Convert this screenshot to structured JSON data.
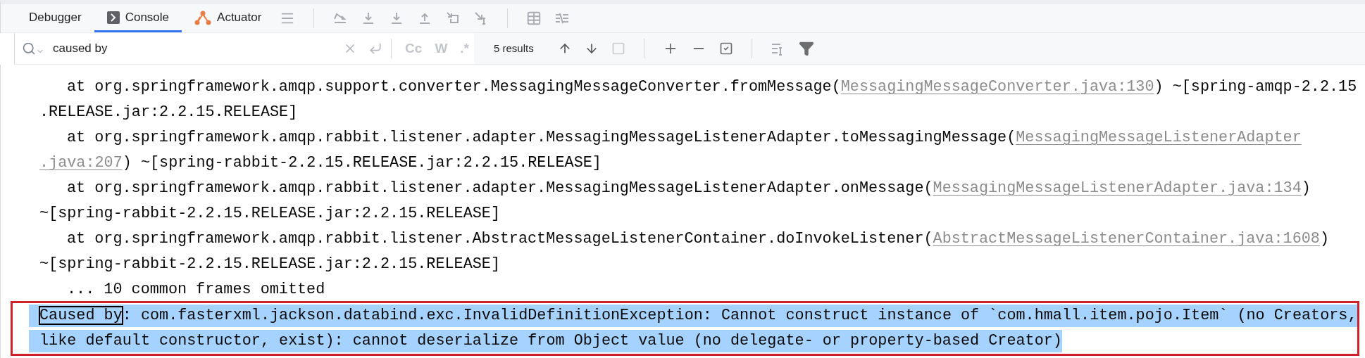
{
  "tabs": [
    {
      "label": "Debugger",
      "selected": false,
      "kind": "plain"
    },
    {
      "label": "Console",
      "selected": true,
      "kind": "console"
    },
    {
      "label": "Actuator",
      "selected": false,
      "kind": "actuator"
    }
  ],
  "search": {
    "value": "caused by",
    "toggles": [
      {
        "label": "Cc",
        "selected": false
      },
      {
        "label": "W",
        "selected": false
      },
      {
        "label": ".*",
        "selected": false
      }
    ],
    "result_count": "5 results"
  },
  "console": {
    "lines": [
      {
        "kind": "frame",
        "selected": false,
        "boxed": false,
        "segments": [
          {
            "kind": "text",
            "text": "at org.springframework.amqp.support.converter.MessagingMessageConverter.fromMessage("
          },
          {
            "kind": "link",
            "text": "MessagingMessageConverter.java:130"
          },
          {
            "kind": "text",
            "text": ") ~[spring-amqp-2.2.15"
          }
        ]
      },
      {
        "kind": "wrap",
        "selected": false,
        "boxed": false,
        "segments": [
          {
            "kind": "text",
            "text": ".RELEASE.jar:2.2.15.RELEASE]"
          }
        ]
      },
      {
        "kind": "frame",
        "selected": false,
        "boxed": false,
        "segments": [
          {
            "kind": "text",
            "text": "at org.springframework.amqp.rabbit.listener.adapter.MessagingMessageListenerAdapter.toMessagingMessage("
          },
          {
            "kind": "link",
            "text": "MessagingMessageListenerAdapter"
          }
        ]
      },
      {
        "kind": "wrap",
        "selected": false,
        "boxed": false,
        "segments": [
          {
            "kind": "link",
            "text": ".java:207"
          },
          {
            "kind": "text",
            "text": ") ~[spring-rabbit-2.2.15.RELEASE.jar:2.2.15.RELEASE]"
          }
        ]
      },
      {
        "kind": "frame",
        "selected": false,
        "boxed": false,
        "segments": [
          {
            "kind": "text",
            "text": "at org.springframework.amqp.rabbit.listener.adapter.MessagingMessageListenerAdapter.onMessage("
          },
          {
            "kind": "link",
            "text": "MessagingMessageListenerAdapter.java:134"
          },
          {
            "kind": "text",
            "text": ")"
          }
        ]
      },
      {
        "kind": "wrap",
        "selected": false,
        "boxed": false,
        "segments": [
          {
            "kind": "text",
            "text": "~[spring-rabbit-2.2.15.RELEASE.jar:2.2.15.RELEASE]"
          }
        ]
      },
      {
        "kind": "frame",
        "selected": false,
        "boxed": false,
        "segments": [
          {
            "kind": "text",
            "text": "at org.springframework.amqp.rabbit.listener.AbstractMessageListenerContainer.doInvokeListener("
          },
          {
            "kind": "link",
            "text": "AbstractMessageListenerContainer.java:1608"
          },
          {
            "kind": "text",
            "text": ")"
          }
        ]
      },
      {
        "kind": "wrap",
        "selected": false,
        "boxed": false,
        "segments": [
          {
            "kind": "text",
            "text": "~[spring-rabbit-2.2.15.RELEASE.jar:2.2.15.RELEASE]"
          }
        ]
      },
      {
        "kind": "frame",
        "selected": false,
        "boxed": false,
        "segments": [
          {
            "kind": "text",
            "text": "... 10 common frames omitted"
          }
        ]
      },
      {
        "kind": "wrap",
        "selected": true,
        "boxed": true,
        "segments": [
          {
            "kind": "match",
            "text": "Caused by"
          },
          {
            "kind": "text",
            "text": ": com.fasterxml.jackson.databind.exc.InvalidDefinitionException: Cannot construct instance of `com.hmall.item.pojo.Item` (no Creators,"
          }
        ]
      },
      {
        "kind": "wrap",
        "selected": true,
        "boxed": true,
        "segments": [
          {
            "kind": "text",
            "text": "like default constructor, exist): cannot deserialize from Object value (no delegate- or property-based Creator)"
          }
        ]
      }
    ]
  }
}
